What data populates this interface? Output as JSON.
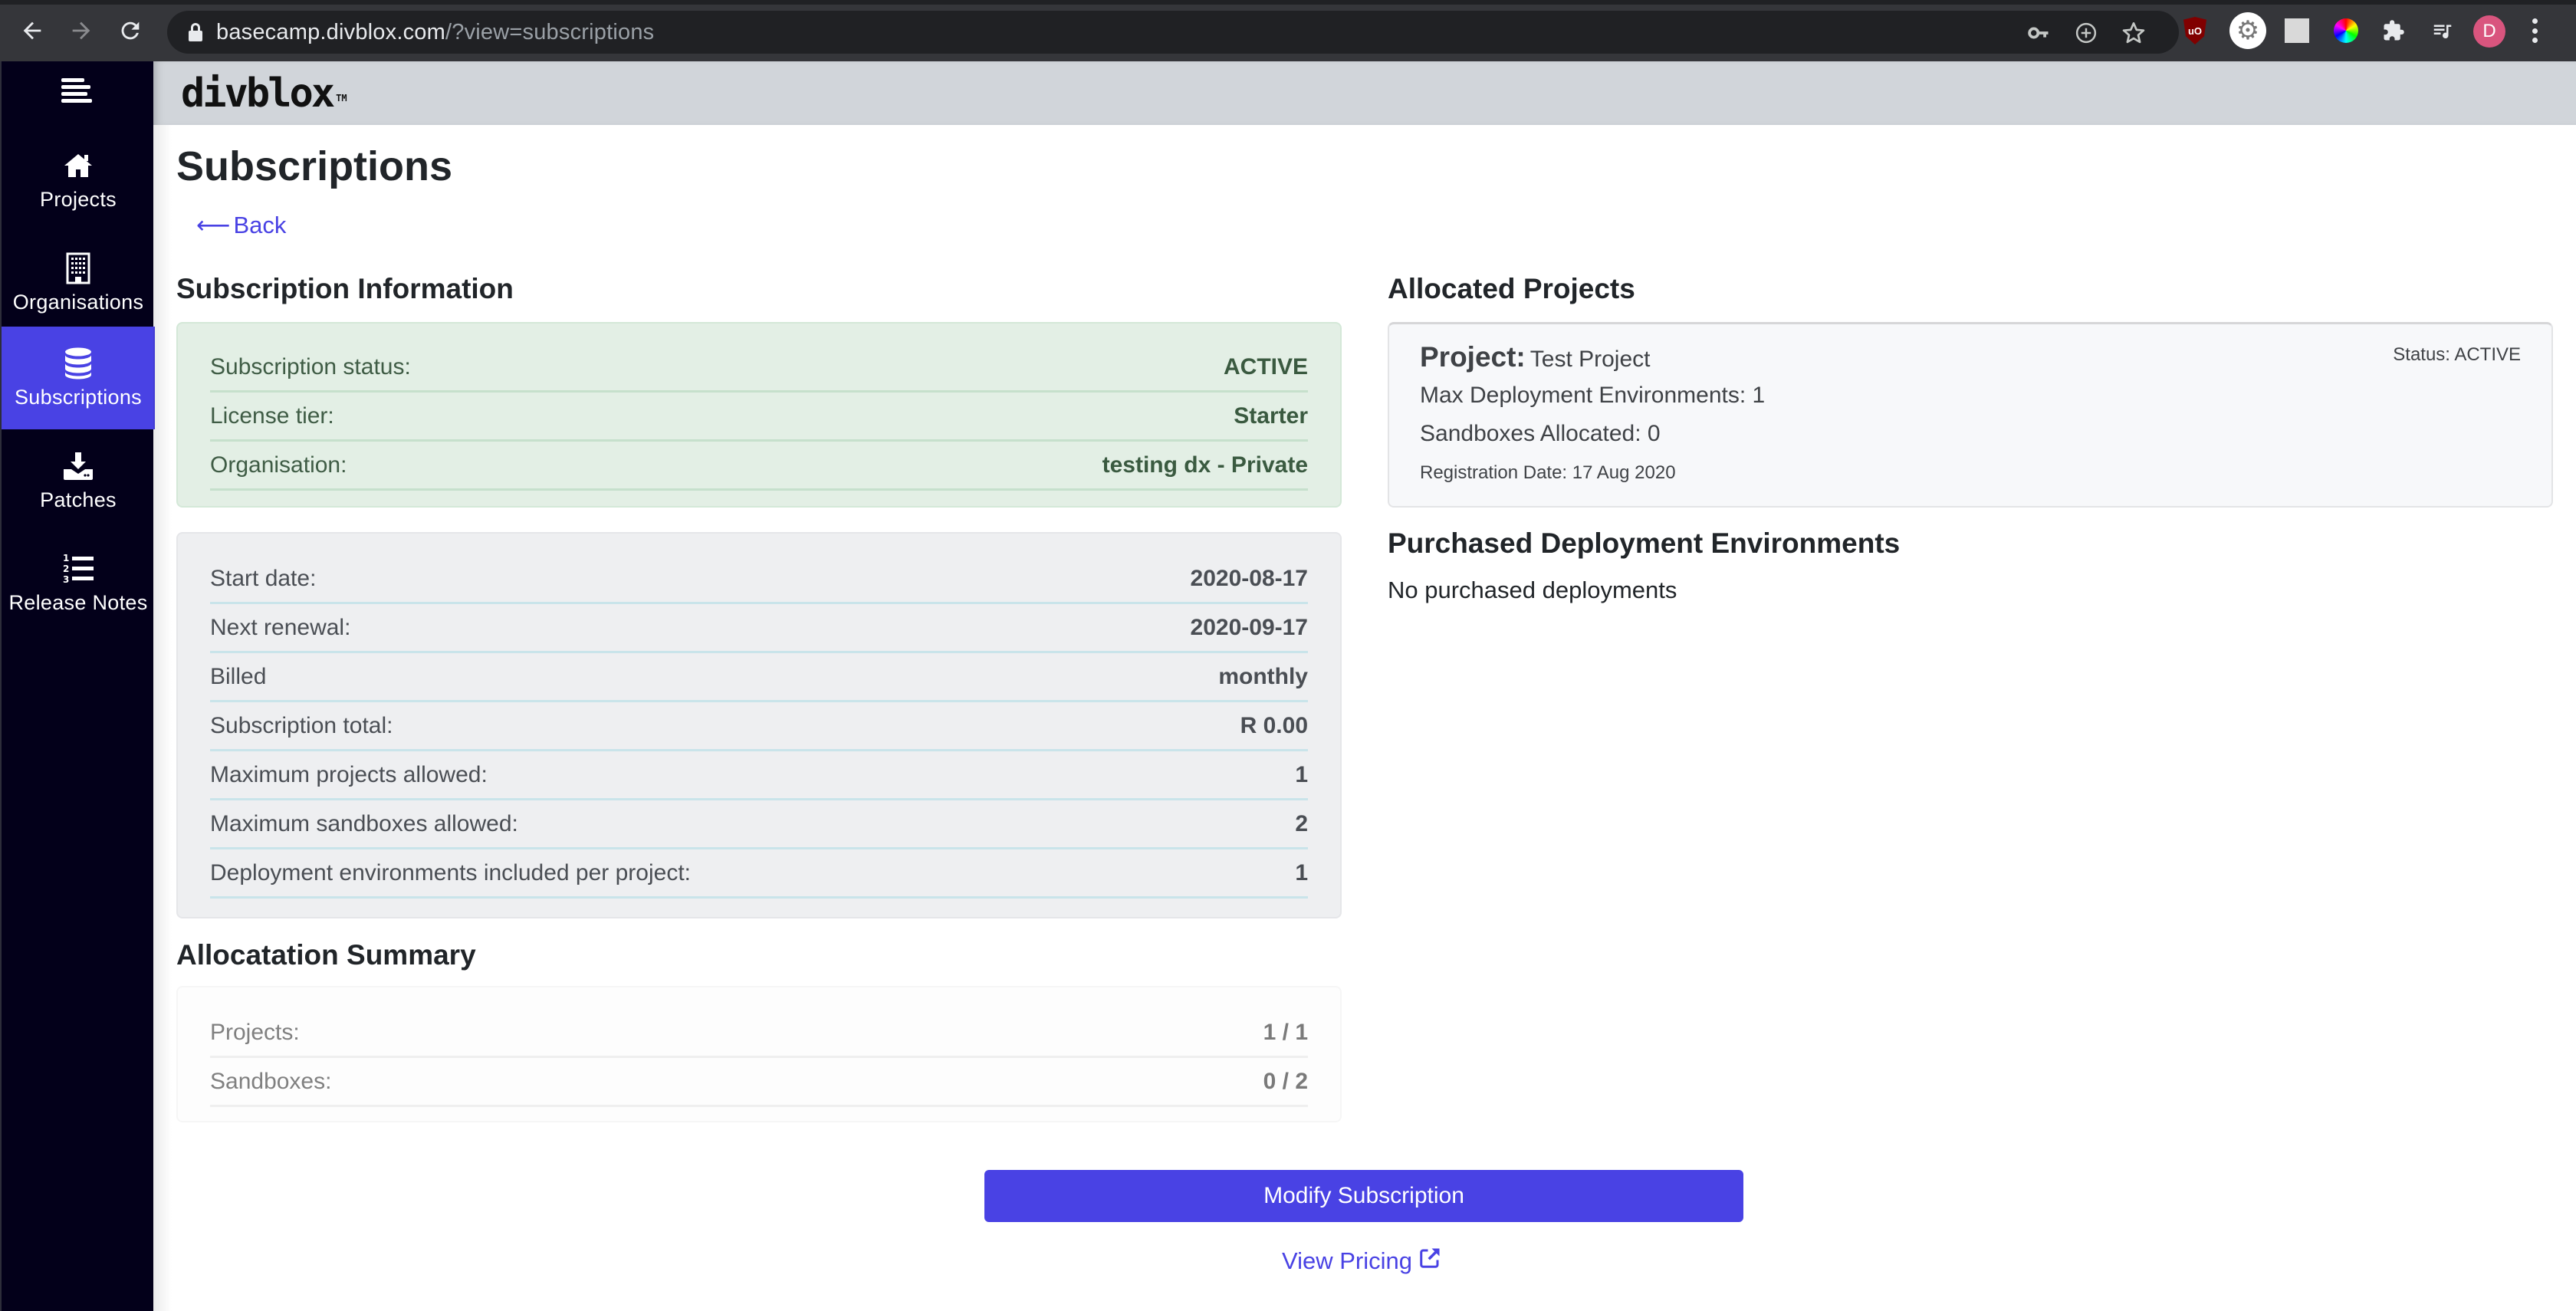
{
  "browser": {
    "url_host": "basecamp.divblox.com",
    "url_path": "/?view=subscriptions",
    "profile_initial": "D",
    "toolbar_icons": [
      "back-icon",
      "forward-icon",
      "reload-icon",
      "lock-icon",
      "key-icon",
      "zoom-plus-icon",
      "bookmark-star-icon",
      "ublock-extension-icon",
      "gear-extension-icon",
      "blank-extension-icon",
      "color-picker-extension-icon",
      "extensions-puzzle-icon",
      "media-queue-icon",
      "profile-avatar",
      "menu-dots-icon"
    ],
    "colors": {
      "profile_avatar": "#d9557e"
    }
  },
  "app": {
    "logo_text": "divblox",
    "logo_tm": "TM",
    "colors": {
      "sidebar_bg": "#03001a",
      "accent": "#4942e4",
      "header_bg": "#d1d5da"
    }
  },
  "sidebar": {
    "items": [
      {
        "label": "Projects",
        "icon": "home-icon",
        "active": false
      },
      {
        "label": "Organisations",
        "icon": "building-icon",
        "active": false
      },
      {
        "label": "Subscriptions",
        "icon": "database-icon",
        "active": true
      },
      {
        "label": "Patches",
        "icon": "download-icon",
        "active": false
      },
      {
        "label": "Release Notes",
        "icon": "ordered-list-icon",
        "active": false
      }
    ]
  },
  "page": {
    "title": "Subscriptions",
    "back_arrow": "⟵",
    "back_label": "Back"
  },
  "subscription_info": {
    "title": "Subscription Information",
    "status_rows": [
      {
        "label": "Subscription status:",
        "value": "ACTIVE"
      },
      {
        "label": "License tier:",
        "value": "Starter"
      },
      {
        "label": "Organisation:",
        "value": "testing dx - Private"
      }
    ],
    "detail_rows": [
      {
        "label": "Start date:",
        "value": "2020-08-17"
      },
      {
        "label": "Next renewal:",
        "value": "2020-09-17"
      },
      {
        "label": "Billed",
        "value": "monthly"
      },
      {
        "label": "Subscription total:",
        "value": "R 0.00"
      },
      {
        "label": "Maximum projects allowed:",
        "value": "1"
      },
      {
        "label": "Maximum sandboxes allowed:",
        "value": "2"
      },
      {
        "label": "Deployment environments included per project:",
        "value": "1"
      }
    ]
  },
  "allocation_summary": {
    "title": "Allocatation Summary",
    "rows": [
      {
        "label": "Projects:",
        "value": "1 / 1"
      },
      {
        "label": "Sandboxes:",
        "value": "0 / 2"
      }
    ]
  },
  "allocated_projects": {
    "title": "Allocated Projects",
    "projects": [
      {
        "name_label": "Project:",
        "name": "Test Project",
        "status": "Status: ACTIVE",
        "max_deployment_envs": "Max Deployment Environments: 1",
        "sandboxes_allocated": "Sandboxes Allocated: 0",
        "registration_date": "Registration Date: 17 Aug 2020"
      }
    ]
  },
  "purchased_deployments": {
    "title": "Purchased Deployment Environments",
    "empty_text": "No purchased deployments"
  },
  "actions": {
    "modify_label": "Modify Subscription",
    "pricing_label": "View Pricing",
    "pricing_icon": "external-link-icon"
  }
}
